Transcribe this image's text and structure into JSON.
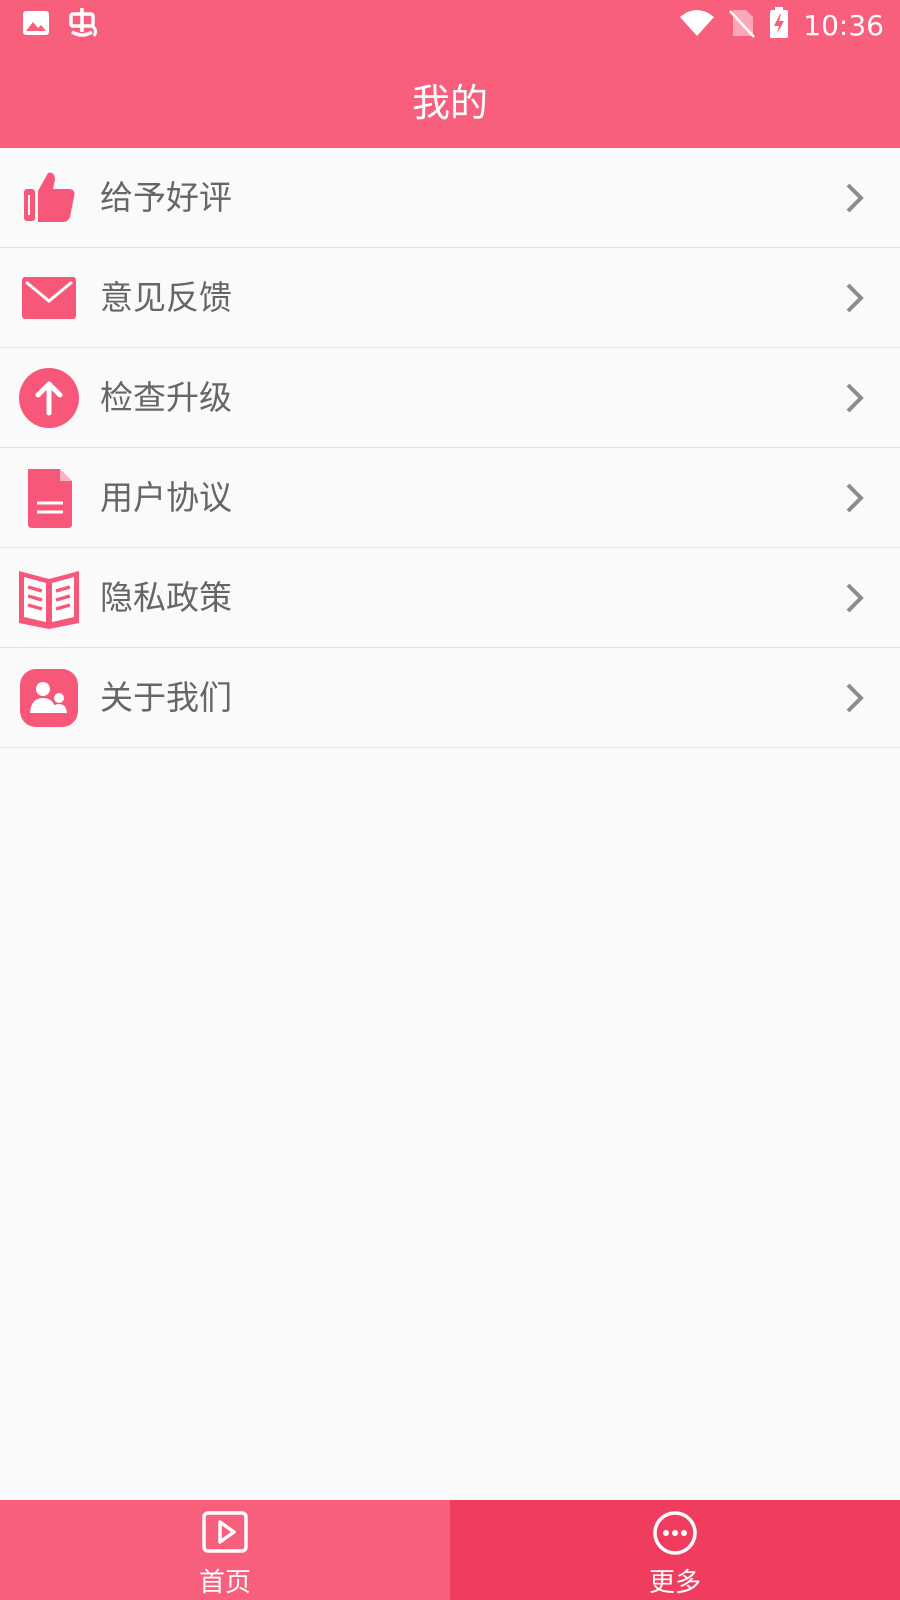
{
  "status_bar": {
    "time": "10:36",
    "left_icons": [
      "image-icon",
      "bug-icon"
    ],
    "right_icons": [
      "wifi-icon",
      "no-sim-icon",
      "battery-charging-icon"
    ]
  },
  "header": {
    "title": "我的"
  },
  "menu": {
    "items": [
      {
        "label": "给予好评",
        "icon": "thumbs-up-icon"
      },
      {
        "label": "意见反馈",
        "icon": "mail-icon"
      },
      {
        "label": "检查升级",
        "icon": "arrow-up-circle-icon"
      },
      {
        "label": "用户协议",
        "icon": "document-icon"
      },
      {
        "label": "隐私政策",
        "icon": "open-book-icon"
      },
      {
        "label": "关于我们",
        "icon": "people-icon"
      }
    ]
  },
  "bottom_nav": {
    "tabs": [
      {
        "label": "首页",
        "icon": "play-box-icon",
        "active": false
      },
      {
        "label": "更多",
        "icon": "more-circle-icon",
        "active": true
      }
    ]
  },
  "colors": {
    "primary": "#f75f7d",
    "active_tab": "#f03d5f",
    "icon": "#f7587a",
    "text": "#666666",
    "chevron": "#8c8c8c"
  }
}
